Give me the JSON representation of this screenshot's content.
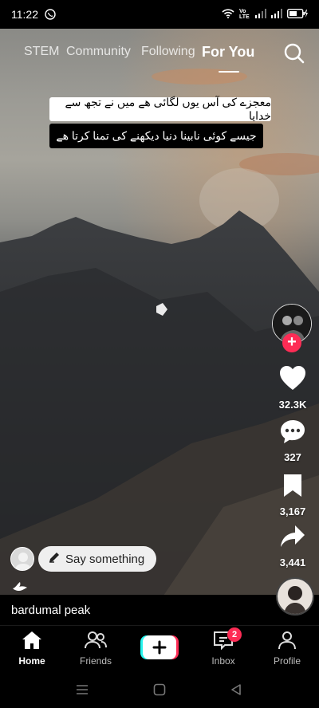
{
  "status_bar": {
    "time": "11:22",
    "network_label": "Vo LTE"
  },
  "top_nav": {
    "tabs": [
      {
        "label": "STEM"
      },
      {
        "label": "Community"
      },
      {
        "label": "Following"
      },
      {
        "label": "For You",
        "active": true
      }
    ]
  },
  "video": {
    "caption_line1": "معجزے کی آس یوں لگائی ھے میں نے تجھ سے خدایا",
    "caption_line2": "جیسے کوئی نابینا دنیا دیکھنے کی تمنا کرتا ھے"
  },
  "actions": {
    "likes": "32.3K",
    "comments": "327",
    "saves": "3,167",
    "shares": "3,441"
  },
  "comment_prompt": {
    "placeholder": "Say something"
  },
  "description": "bardumal peak",
  "bottom_nav": {
    "items": [
      {
        "label": "Home",
        "active": true
      },
      {
        "label": "Friends"
      },
      {
        "label": "Inbox",
        "badge": "2"
      },
      {
        "label": "Profile"
      }
    ]
  },
  "colors": {
    "accent": "#fe2c55",
    "create_cyan": "#25f4ee"
  }
}
